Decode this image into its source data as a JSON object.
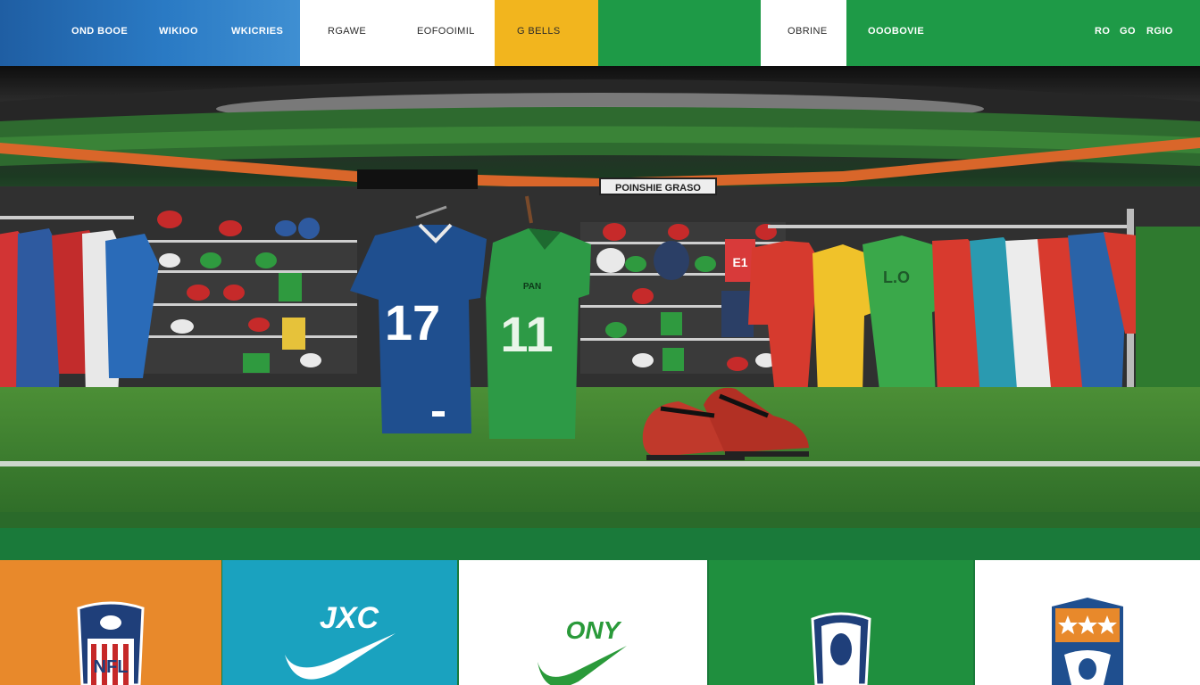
{
  "nav": {
    "items": [
      {
        "label": "OND BOOE"
      },
      {
        "label": "WIKIOO"
      },
      {
        "label": "WKICRIES"
      },
      {
        "label": "RGAWE"
      },
      {
        "label": "EOFOOIMIL"
      },
      {
        "label": "G BELLS"
      },
      {
        "label": "OBRINE"
      },
      {
        "label": "OOOBOVIE"
      },
      {
        "label": "RO"
      },
      {
        "label": "GO"
      },
      {
        "label": "RGIO"
      }
    ]
  },
  "hero": {
    "store_sign": "POINSHIE GRASO",
    "jersey_blue_number": "17",
    "jersey_green_number": "11",
    "jersey_green_chest": "PAN",
    "jersey_right_number": "L.O",
    "jersey_red_rack_number": "E1"
  },
  "brands": {
    "panels": [
      {
        "name": "NFL"
      },
      {
        "name": "JXC"
      },
      {
        "name": "ONY"
      },
      {
        "name": "shield"
      },
      {
        "name": "crest"
      }
    ]
  },
  "colors": {
    "nav_blue": "#2a7ac4",
    "nav_yellow": "#f2b51e",
    "nav_green": "#1e9a47",
    "orange": "#e8892b",
    "teal": "#1aa2bf",
    "field_green": "#3e8d3a"
  }
}
